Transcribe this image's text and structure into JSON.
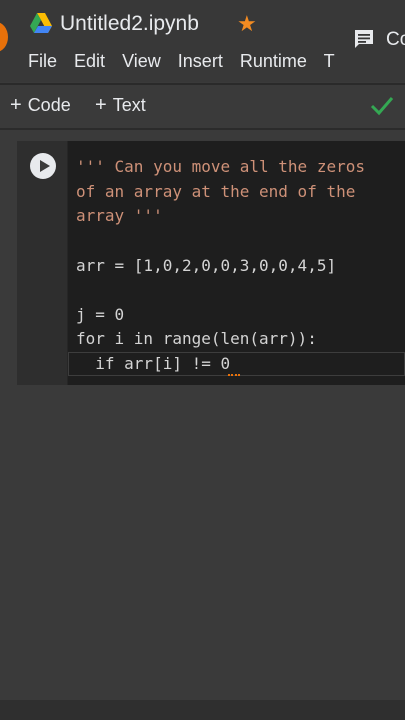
{
  "header": {
    "title": "Untitled2.ipynb",
    "comment_label": "Co"
  },
  "menu": [
    "File",
    "Edit",
    "View",
    "Insert",
    "Runtime",
    "T"
  ],
  "toolbar": {
    "code_label": "Code",
    "text_label": "Text"
  },
  "colors": {
    "accent_orange": "#f28b22",
    "check_green": "#34a853",
    "string": "#ce9178",
    "keyword": "#569cd6"
  },
  "cell": {
    "lines": [
      "''' Can you move all the zeros",
      "of an array at the end of the",
      "array '''",
      "",
      "arr = [1,0,2,0,0,3,0,0,4,5]",
      "",
      "j = 0",
      "for i in range(len(arr)):",
      "  if arr[i] != 0"
    ]
  }
}
